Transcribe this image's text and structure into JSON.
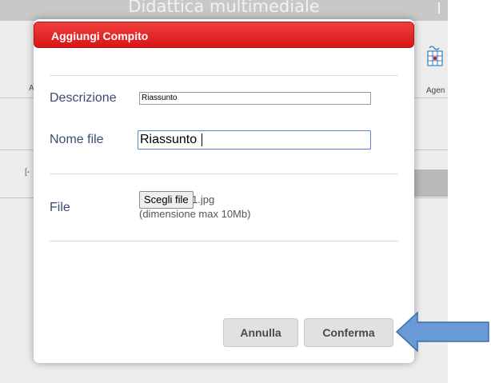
{
  "background": {
    "header_title": "Didattica multimediale",
    "left_text_1": "A",
    "left_text_2": "[-",
    "agenda_label": "Agen",
    "agenda_icon": "calendar-icon"
  },
  "dialog": {
    "title": "Aggiungi Compito",
    "accent_color": "#e02020",
    "fields": {
      "descrizione": {
        "label": "Descrizione",
        "value": "Riassunto"
      },
      "nome_file": {
        "label": "Nome file",
        "value": "Riassunto"
      },
      "file": {
        "label": "File",
        "button_label": "Scegli file",
        "selected_file": "1.jpg",
        "hint": "(dimensione max 10Mb)"
      }
    },
    "buttons": {
      "cancel": "Annulla",
      "confirm": "Conferma"
    }
  },
  "annotation": {
    "arrow_color": "#6a9ad6",
    "arrow_icon": "left-arrow-icon"
  }
}
